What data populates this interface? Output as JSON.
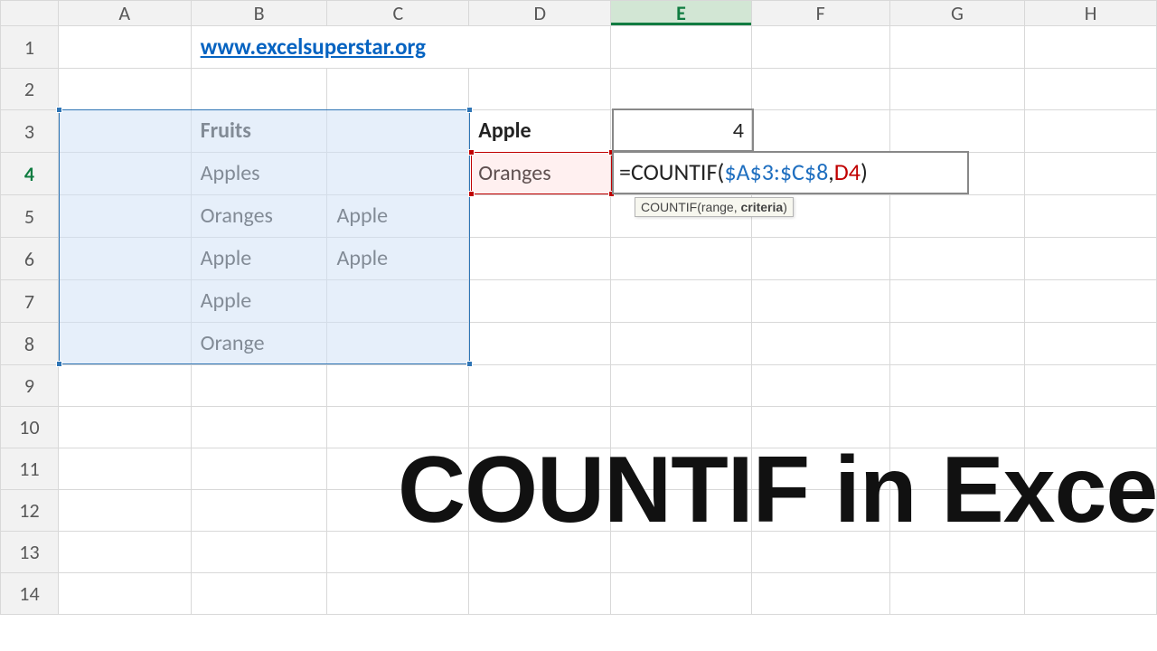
{
  "columns": [
    "A",
    "B",
    "C",
    "D",
    "E",
    "F",
    "G",
    "H"
  ],
  "rows": [
    "1",
    "2",
    "3",
    "4",
    "5",
    "6",
    "7",
    "8",
    "9",
    "10",
    "11",
    "12",
    "13",
    "14"
  ],
  "active_row": "4",
  "active_col": "E",
  "link_text": "www.excelsuperstar.org",
  "cells": {
    "B3": "Fruits",
    "B4": "Apples",
    "B5": "Oranges",
    "B6": "Apple",
    "B7": "Apple",
    "B8": "Orange",
    "C5": "Apple",
    "C6": "Apple",
    "D3": "Apple",
    "D4": "Oranges",
    "E3": "4"
  },
  "formula": {
    "prefix": "=COUNTIF(",
    "range": "$A$3:$C$8",
    "sep": ",",
    "criteria": "D4",
    "suffix": ")"
  },
  "tooltip": {
    "fn": "COUNTIF(",
    "arg1": "range",
    "sep": ", ",
    "arg2": "criteria",
    "close": ")"
  },
  "title_text": "COUNTIF in Excel",
  "chart_data": {
    "type": "table",
    "headers": [
      "Fruits",
      ""
    ],
    "rows": [
      [
        "Apples",
        ""
      ],
      [
        "Oranges",
        "Apple"
      ],
      [
        "Apple",
        "Apple"
      ],
      [
        "Apple",
        ""
      ],
      [
        "Orange",
        ""
      ]
    ],
    "lookup": [
      {
        "criteria": "Apple",
        "count": 4
      },
      {
        "criteria": "Oranges",
        "formula": "=COUNTIF($A$3:$C$8,D4)"
      }
    ]
  }
}
